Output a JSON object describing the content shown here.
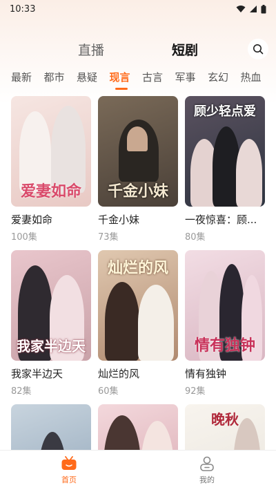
{
  "status": {
    "time": "10:33"
  },
  "header": {
    "tab_live": "直播",
    "tab_short": "短剧"
  },
  "categories": [
    "最新",
    "都市",
    "悬疑",
    "现言",
    "古言",
    "军事",
    "玄幻",
    "热血"
  ],
  "active_category": "现言",
  "cards": [
    {
      "name": "爱妻如命",
      "episodes": "100集",
      "art": "爱妻如命",
      "colors": [
        "#e8c9c4",
        "#f6e6e2"
      ]
    },
    {
      "name": "千金小妹",
      "episodes": "73集",
      "art": "千金小妹",
      "colors": [
        "#4a4038",
        "#7a6a58"
      ]
    },
    {
      "name": "一夜惊喜：顾...",
      "episodes": "80集",
      "art": "顾少轻点爱",
      "colors": [
        "#2e3440",
        "#5b5260"
      ]
    },
    {
      "name": "我家半边天",
      "episodes": "82集",
      "art": "我家半边天",
      "colors": [
        "#c9a2a8",
        "#e9c6cc"
      ]
    },
    {
      "name": "灿烂的风",
      "episodes": "60集",
      "art": "灿烂的风",
      "colors": [
        "#b08a70",
        "#e0c8b0"
      ]
    },
    {
      "name": "情有独钟",
      "episodes": "92集",
      "art": "情有独钟",
      "colors": [
        "#d9b6c2",
        "#f2dde4"
      ]
    },
    {
      "name": "",
      "episodes": "",
      "art": "",
      "colors": [
        "#8fa4b8",
        "#c8d4de"
      ]
    },
    {
      "name": "",
      "episodes": "",
      "art": "",
      "colors": [
        "#d7a6ae",
        "#f3d8dc"
      ]
    },
    {
      "name": "",
      "episodes": "",
      "art": "晚秋",
      "colors": [
        "#e8e4dc",
        "#f8f4ee"
      ]
    }
  ],
  "nav": {
    "home": "首页",
    "me": "我的"
  },
  "colors": {
    "accent": "#ff6a1a"
  }
}
